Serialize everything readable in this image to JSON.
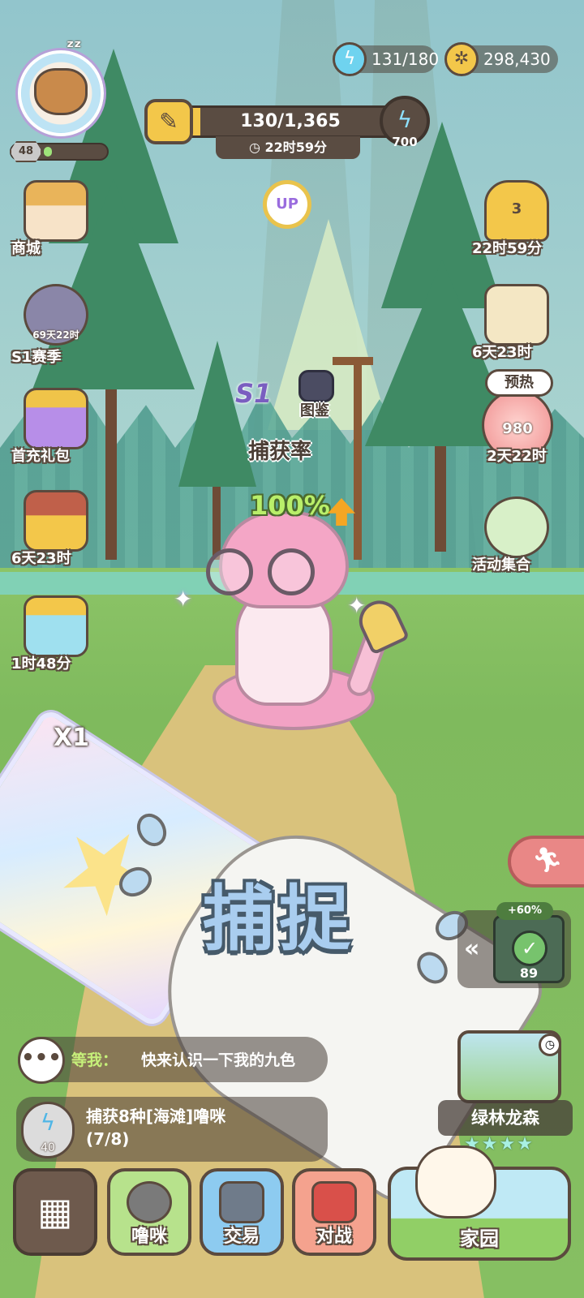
{
  "resources": {
    "energy": "131/180",
    "coins": "298,430"
  },
  "player": {
    "level": "48",
    "level_progress": 0.1
  },
  "pass": {
    "progress": "130/1,365",
    "progress_fraction": 0.095,
    "timer": "22时59分",
    "reward_value": "700"
  },
  "up_label": "UP",
  "left_menu": {
    "shop": "商城",
    "season_timer": "69天22时",
    "season": "S1赛季",
    "first_pack": "首充礼包",
    "chest_timer": "6天23时",
    "gift_timer": "1时48分"
  },
  "right_menu": {
    "trophy_rank": "3",
    "trophy_timer": "22时59分",
    "map_timer": "6天23时",
    "preheat": "预热",
    "peach_count": "980",
    "peach_timer": "2天22时",
    "events": "活动集合"
  },
  "center": {
    "season_logo": "S1",
    "book": "图鉴",
    "rate_label": "捕获率",
    "rate_value": "100%"
  },
  "card": {
    "multiplier": "X1"
  },
  "catch_label": "捕捉",
  "item": {
    "bonus": "+60%",
    "count": "89"
  },
  "chat": {
    "name": "等我：",
    "message": "快来认识一下我的九色"
  },
  "quest": {
    "cost": "40",
    "title": "捕获8种[海滩]噜咪",
    "progress": "(7/8)"
  },
  "map": {
    "name": "绿林龙森",
    "stars": "★★★★"
  },
  "nav": {
    "pet": "噜咪",
    "trade": "交易",
    "battle": "对战",
    "home": "家园"
  }
}
